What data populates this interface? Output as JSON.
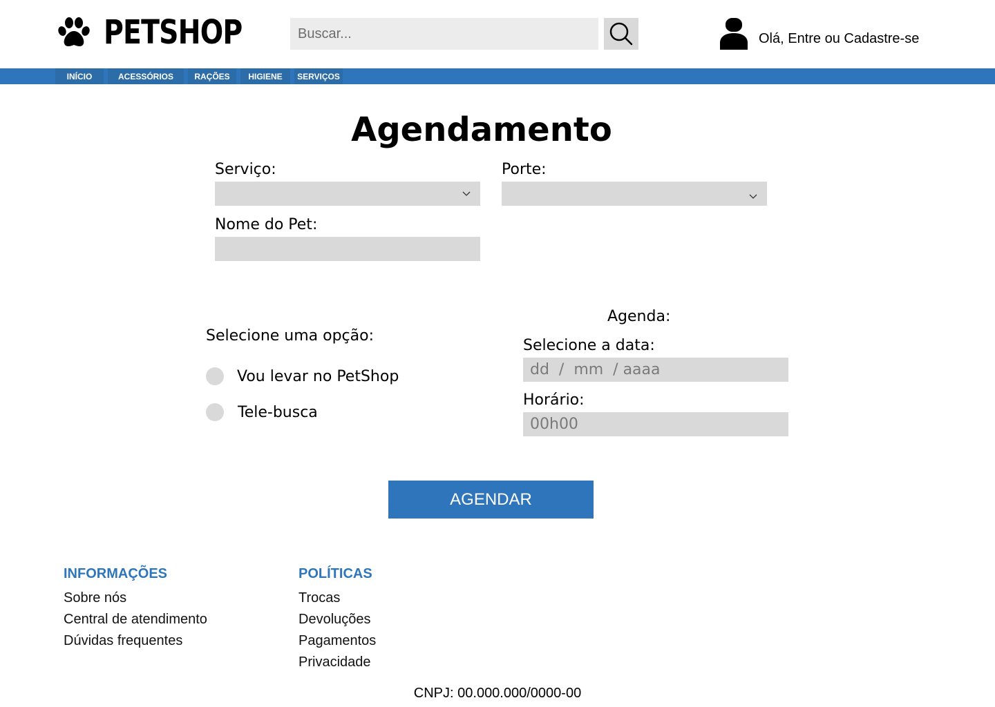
{
  "header": {
    "logo_text": "PETSHOP",
    "logo_icon": "paw-icon",
    "search": {
      "placeholder": "Buscar...",
      "value": "",
      "icon": "search-icon"
    },
    "user": {
      "icon": "user-icon",
      "greeting": "Olá, Entre ou Cadastre-se"
    }
  },
  "nav": {
    "items": [
      {
        "label": "INÍCIO"
      },
      {
        "label": "ACESSÓRIOS"
      },
      {
        "label": "RAÇÕES"
      },
      {
        "label": "HIGIENE"
      },
      {
        "label": "SERVIÇOS"
      }
    ]
  },
  "form": {
    "title": "Agendamento",
    "service": {
      "label": "Serviço:",
      "value": ""
    },
    "size": {
      "label": "Porte:",
      "value": ""
    },
    "pet_name": {
      "label": "Nome do Pet:",
      "value": ""
    },
    "option": {
      "label": "Selecione uma opção:",
      "choices": [
        {
          "label": "Vou levar no PetShop",
          "checked": false
        },
        {
          "label": "Tele-busca",
          "checked": false
        }
      ]
    },
    "schedule": {
      "heading": "Agenda:",
      "date_label": "Selecione a data:",
      "date_placeholder": "dd  /  mm  / aaaa",
      "time_label": "Horário:",
      "time_placeholder": "00h00"
    },
    "submit_label": "AGENDAR"
  },
  "footer": {
    "info": {
      "heading": "INFORMAÇÕES",
      "links": [
        "Sobre nós",
        "Central de atendimento",
        "Dúvidas frequentes"
      ]
    },
    "policies": {
      "heading": "POLÍTICAS",
      "links": [
        "Trocas",
        "Devoluções",
        "Pagamentos",
        "Privacidade"
      ]
    },
    "cnpj": "CNPJ: 00.000.000/0000-00"
  },
  "colors": {
    "brand_blue": "#2f75bb",
    "field_gray": "#d9d9d9",
    "search_gray": "#ececec"
  }
}
